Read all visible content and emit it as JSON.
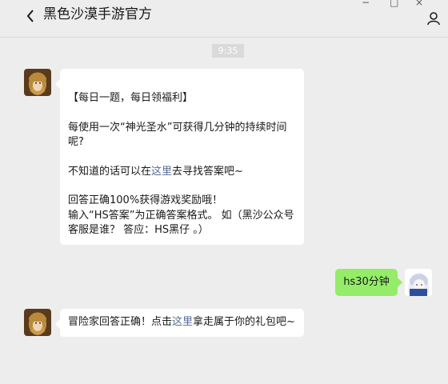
{
  "header": {
    "title": "黑色沙漠手游官方",
    "back_icon": "chevron-left-icon",
    "window_controls": [
      "−",
      "□",
      "×"
    ],
    "user_icon": "user-icon"
  },
  "timestamp": "9:35",
  "messages": [
    {
      "lines": [
        "【每日一题，每日领福利】",
        "每使用一次“神光圣水”可获得几分钟的持续时间呢?",
        "不知道的话可以在",
        "这里",
        "去寻找答案吧~",
        "回答正确100%获得游戏奖励哦！",
        "输入“HS答案”为正确答案格式。 如（黑沙公众号客服是谁？ 答应：HS黑仔 。）"
      ]
    },
    {
      "text": "hs30分钟"
    },
    {
      "prefix": "冒险家回答正确！点击",
      "link": "这里",
      "suffix": "拿走属于你的礼包吧~"
    }
  ],
  "colors": {
    "background": "#ededed",
    "bubble_left": "#ffffff",
    "bubble_right": "#95ec69",
    "link": "#576b95"
  }
}
